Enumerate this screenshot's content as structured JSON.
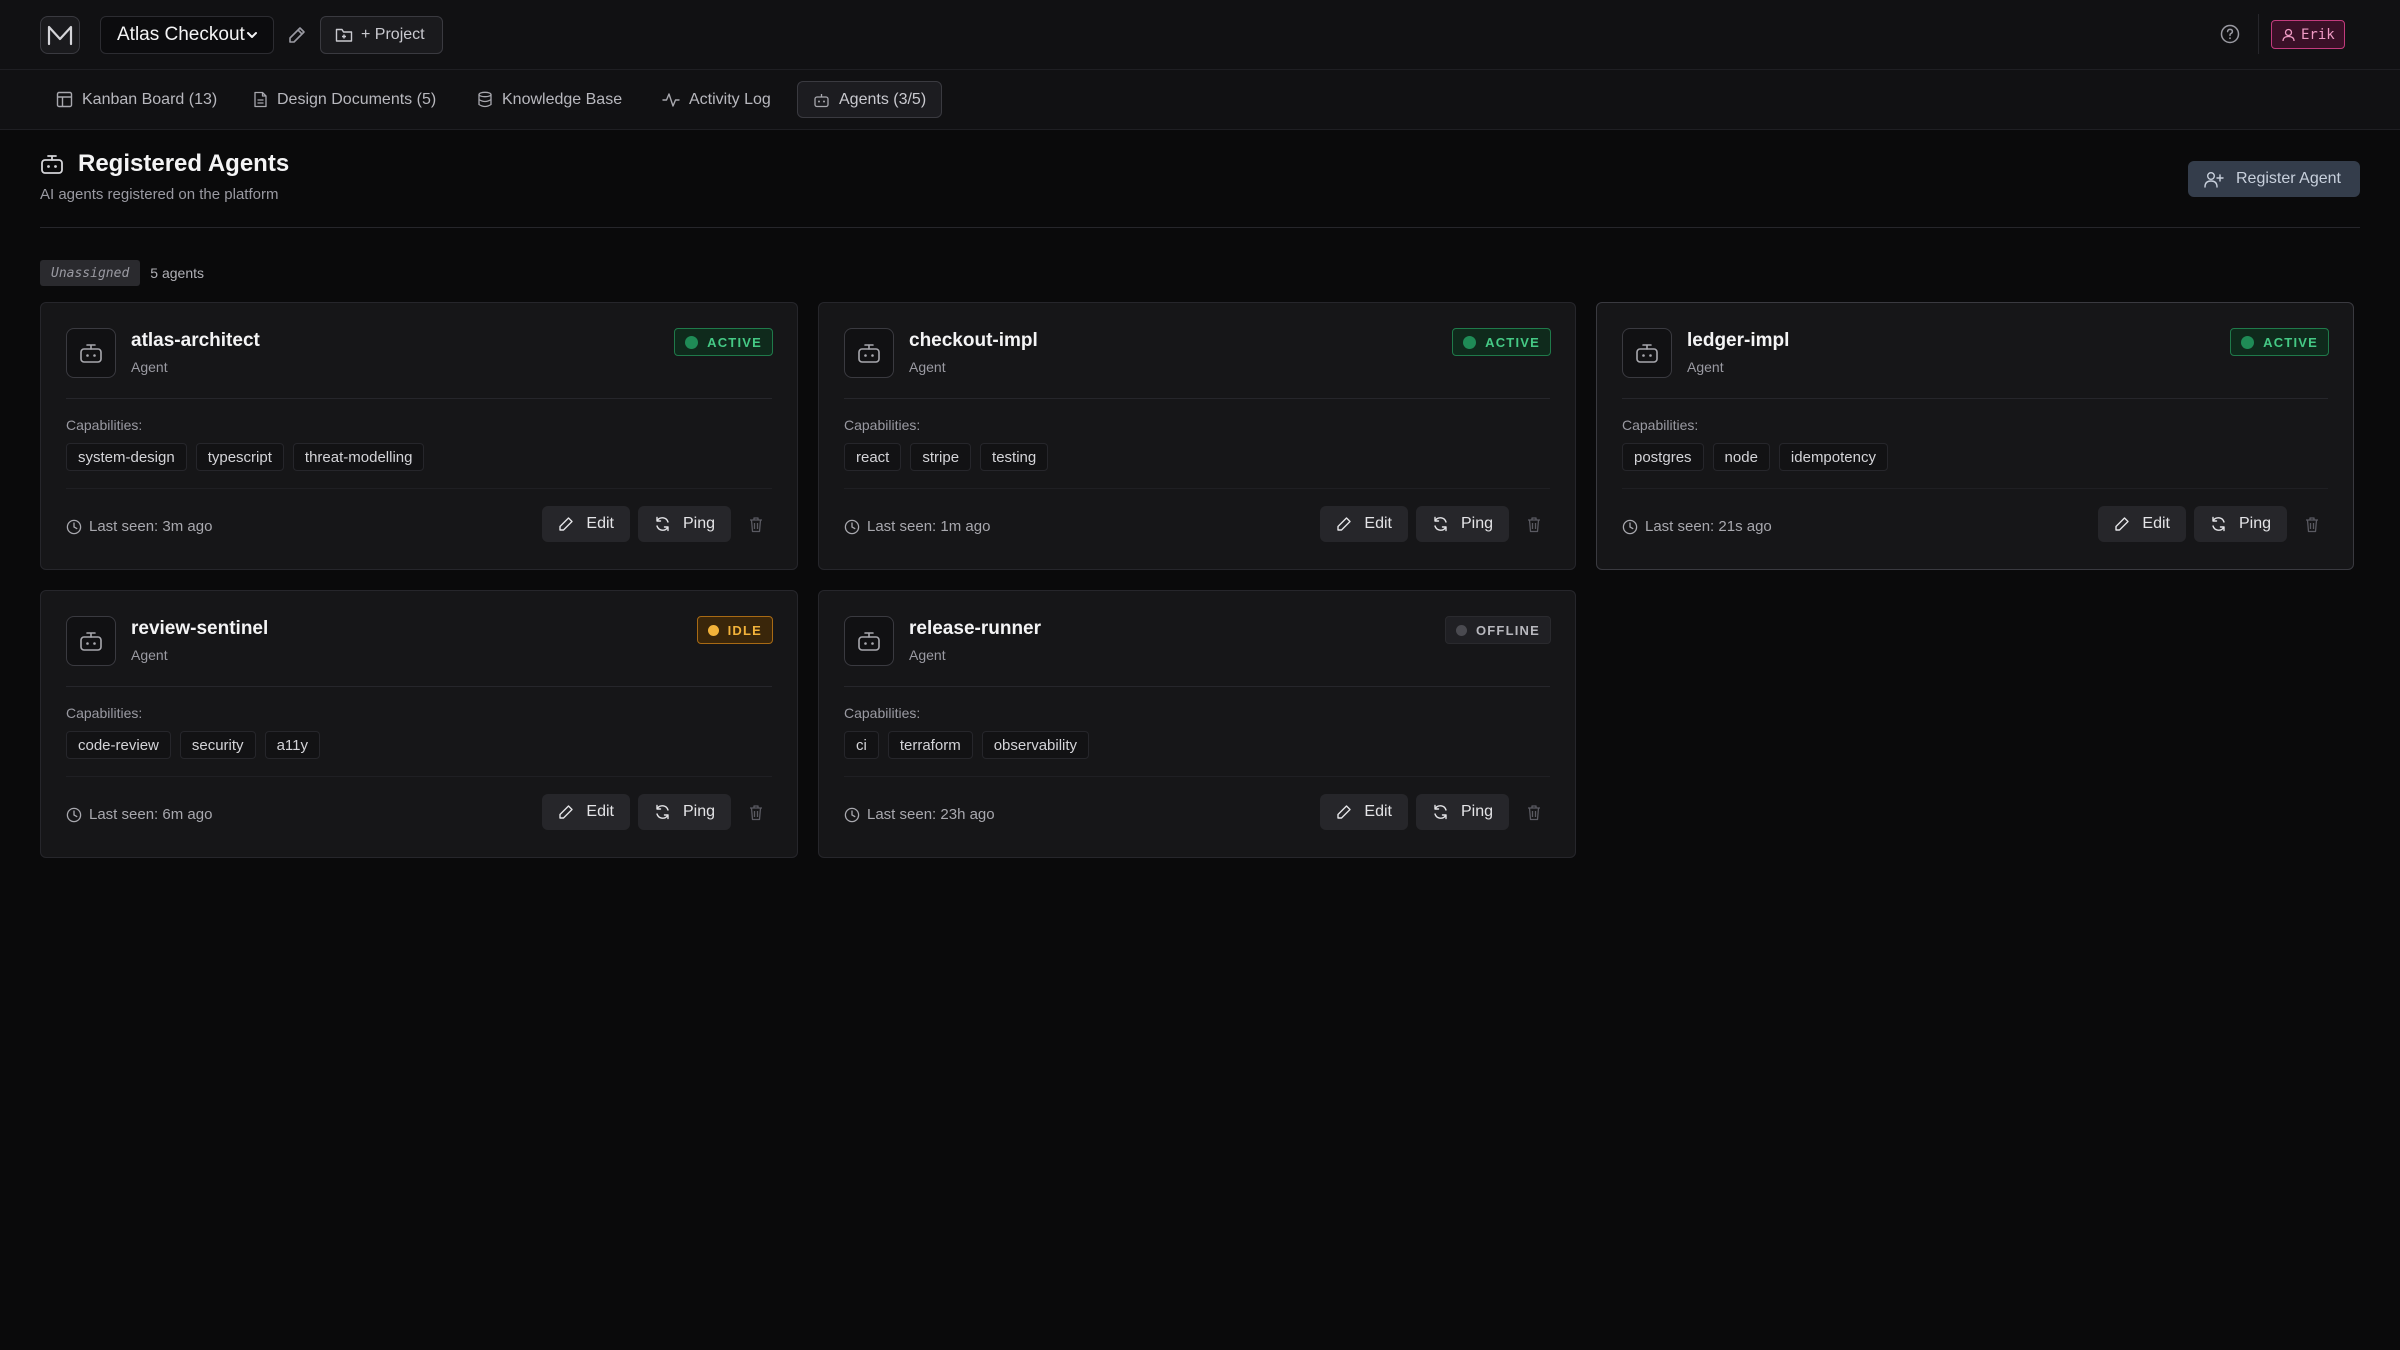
{
  "header": {
    "logo_icon": "m-logo-icon",
    "project_name": "Atlas Checkout",
    "add_project_label": "+ Project",
    "user_name": "Erik"
  },
  "nav": {
    "tabs": [
      {
        "label": "Kanban Board (13)",
        "icon": "board-icon"
      },
      {
        "label": "Design Documents (5)",
        "icon": "document-icon"
      },
      {
        "label": "Knowledge Base",
        "icon": "database-icon"
      },
      {
        "label": "Activity Log",
        "icon": "activity-icon"
      },
      {
        "label": "Agents (3/5)",
        "icon": "robot-icon",
        "active": true
      }
    ]
  },
  "page": {
    "title": "Registered Agents",
    "subtitle": "AI agents registered on the platform",
    "register_label": "Register Agent"
  },
  "group": {
    "label": "Unassigned",
    "count": "5 agents"
  },
  "labels": {
    "capabilities": "Capabilities:",
    "edit": "Edit",
    "ping": "Ping"
  },
  "colors": {
    "active": "#45c985",
    "idle": "#f2b23a",
    "offline": "#b8b8be",
    "user_badge": "#f09ac4"
  },
  "agents": [
    {
      "name": "atlas-architect",
      "type": "Agent",
      "status": "ACTIVE",
      "capabilities": [
        "system-design",
        "typescript",
        "threat-modelling"
      ],
      "last_seen": "Last seen: 3m ago"
    },
    {
      "name": "checkout-impl",
      "type": "Agent",
      "status": "ACTIVE",
      "capabilities": [
        "react",
        "stripe",
        "testing"
      ],
      "last_seen": "Last seen: 1m ago"
    },
    {
      "name": "ledger-impl",
      "type": "Agent",
      "status": "ACTIVE",
      "capabilities": [
        "postgres",
        "node",
        "idempotency"
      ],
      "last_seen": "Last seen: 21s ago"
    },
    {
      "name": "review-sentinel",
      "type": "Agent",
      "status": "IDLE",
      "capabilities": [
        "code-review",
        "security",
        "a11y"
      ],
      "last_seen": "Last seen: 6m ago"
    },
    {
      "name": "release-runner",
      "type": "Agent",
      "status": "OFFLINE",
      "capabilities": [
        "ci",
        "terraform",
        "observability"
      ],
      "last_seen": "Last seen: 23h ago"
    }
  ]
}
